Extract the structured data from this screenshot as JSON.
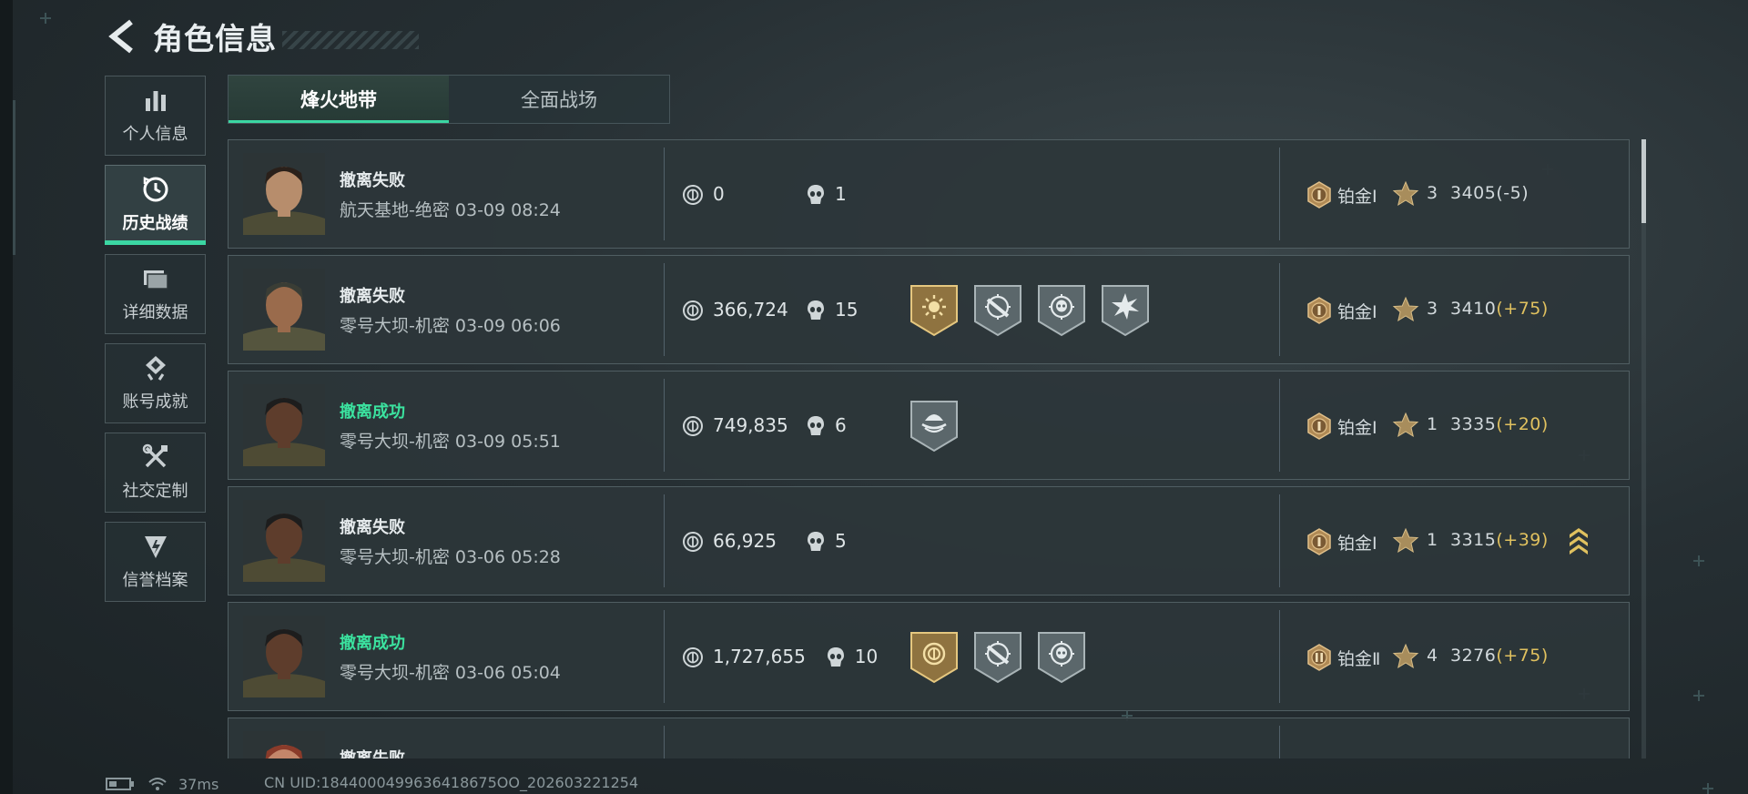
{
  "header": {
    "title": "角色信息"
  },
  "sidebar": {
    "items": [
      {
        "label": "个人信息",
        "icon": "bar-chart-icon",
        "active": false
      },
      {
        "label": "历史战绩",
        "icon": "history-clock-icon",
        "active": true
      },
      {
        "label": "详细数据",
        "icon": "folder-icon",
        "active": false
      },
      {
        "label": "账号成就",
        "icon": "achievement-icon",
        "active": false
      },
      {
        "label": "社交定制",
        "icon": "tools-icon",
        "active": false
      },
      {
        "label": "信誉档案",
        "icon": "credit-icon",
        "active": false
      }
    ]
  },
  "tabs": [
    {
      "label": "烽火地带",
      "active": true
    },
    {
      "label": "全面战场",
      "active": false
    }
  ],
  "matches": [
    {
      "result": "撤离失败",
      "success": false,
      "map": "航天基地-绝密 03-09 08:24",
      "money": "0",
      "kills": "1",
      "badges": [],
      "rank": "铂金Ⅰ",
      "stars": "3",
      "score": "3405",
      "delta": "(-5)",
      "delta_positive": false,
      "promo": false
    },
    {
      "result": "撤离失败",
      "success": false,
      "map": "零号大坝-机密 03-09 06:06",
      "money": "366,724",
      "kills": "15",
      "badges": [
        "gold-sun-badge",
        "silver-target-rifle-badge",
        "silver-target-skull-badge",
        "silver-burst-badge"
      ],
      "rank": "铂金Ⅰ",
      "stars": "3",
      "score": "3410",
      "delta": "(+75)",
      "delta_positive": true,
      "promo": false
    },
    {
      "result": "撤离成功",
      "success": true,
      "map": "零号大坝-机密 03-09 05:51",
      "money": "749,835",
      "kills": "6",
      "badges": [
        "silver-evac-badge"
      ],
      "rank": "铂金Ⅰ",
      "stars": "1",
      "score": "3335",
      "delta": "(+20)",
      "delta_positive": true,
      "promo": false
    },
    {
      "result": "撤离失败",
      "success": false,
      "map": "零号大坝-机密 03-06 05:28",
      "money": "66,925",
      "kills": "5",
      "badges": [],
      "rank": "铂金Ⅰ",
      "stars": "1",
      "score": "3315",
      "delta": "(+39)",
      "delta_positive": true,
      "promo": true
    },
    {
      "result": "撤离成功",
      "success": true,
      "map": "零号大坝-机密 03-06 05:04",
      "money": "1,727,655",
      "kills": "10",
      "badges": [
        "gold-coin-badge",
        "silver-target-rifle-badge",
        "silver-target-skull-badge"
      ],
      "rank": "铂金Ⅱ",
      "stars": "4",
      "score": "3276",
      "delta": "(+75)",
      "delta_positive": true,
      "promo": false
    },
    {
      "result": "撤离失败",
      "success": false,
      "map": "",
      "money": "",
      "kills": "",
      "badges": [],
      "rank": "",
      "stars": "",
      "score": "",
      "delta": "",
      "delta_positive": false,
      "promo": false
    }
  ],
  "footer": {
    "ping": "37ms",
    "uid": "CN UID:1844000499636418675OO_202603221254"
  },
  "colors": {
    "accent": "#3bd6a2",
    "success": "#3be29f",
    "delta": "#e0c15f"
  }
}
